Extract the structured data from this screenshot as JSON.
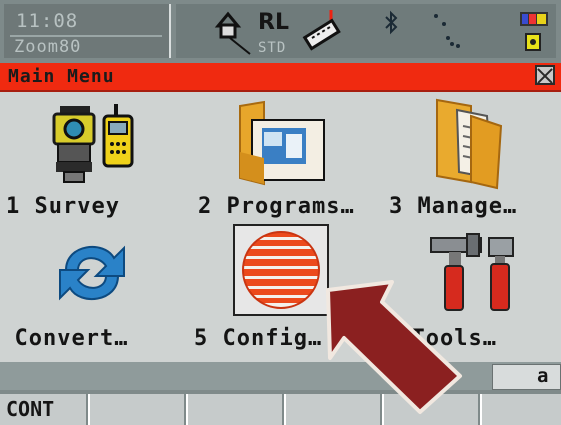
{
  "status": {
    "time": "11:08",
    "zoom": "Zoom80",
    "mode_label": "RL",
    "mode_sub": "STD"
  },
  "titlebar": {
    "title": "Main Menu"
  },
  "menu": {
    "items": [
      {
        "label": "1 Survey",
        "icon": "survey-instrument-icon"
      },
      {
        "label": "2 Programs…",
        "icon": "programs-folder-icon"
      },
      {
        "label": "3 Manage…",
        "icon": "manage-folder-icon"
      },
      {
        "label": "4 Convert…",
        "icon": "convert-arrows-icon"
      },
      {
        "label": "5 Config…",
        "icon": "config-globe-icon"
      },
      {
        "label": "6 Tools…",
        "icon": "tools-icon"
      }
    ]
  },
  "input_mode": "a",
  "softkeys": [
    "CONT",
    "",
    "",
    "",
    "",
    ""
  ],
  "colors": {
    "title_bar": "#f02a10",
    "screen_bg": "#cfd3d2",
    "status_bg": "#7e8a8a",
    "arrow": "#8b2020"
  }
}
